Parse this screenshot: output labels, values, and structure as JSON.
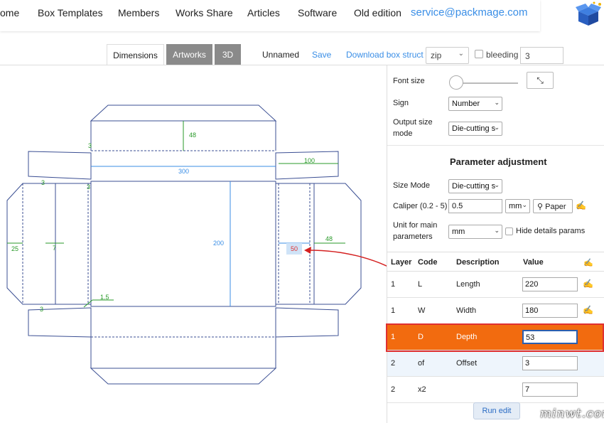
{
  "nav": {
    "items": [
      "ome",
      "Box Templates",
      "Members",
      "Works Share",
      "Articles",
      "Software",
      "Old edition"
    ],
    "email": "service@packmage.com"
  },
  "toolbar": {
    "tabs": [
      "Dimensions",
      "Artworks",
      "3D"
    ],
    "name": "Unnamed",
    "save": "Save",
    "download": "Download box struct",
    "format": "zip",
    "bleeding_label": "bleeding",
    "bleeding_value": "3"
  },
  "canvas": {
    "labels": {
      "top_height": "48",
      "left_flap": "100",
      "width": "300",
      "height": "200",
      "right_flap": "48",
      "left_tab": "25",
      "small_3a": "3",
      "small_3b": "3",
      "small_3c": "3",
      "small_3d": "3",
      "small_7": "7",
      "offset": "1.5",
      "depth": "50"
    }
  },
  "panel": {
    "font_size_label": "Font size",
    "font_size_level": 0,
    "sign_label": "Sign",
    "sign_value": "Number",
    "output_label_1": "Output size",
    "output_label_2": "mode",
    "output_value": "Die-cutting s",
    "section_title": "Parameter adjustment",
    "size_mode_label": "Size Mode",
    "size_mode_value": "Die-cutting s",
    "caliper_label": "Caliper (0.2 - 5)",
    "caliper_value": "0.5",
    "caliper_unit": "mm",
    "paper_button": "Paper",
    "unit_label_1": "Unit for main",
    "unit_label_2": "parameters",
    "unit_value": "mm",
    "hide_details": "Hide details params",
    "table": {
      "headers": [
        "Layer",
        "Code",
        "Description",
        "Value"
      ],
      "rows": [
        {
          "layer": "1",
          "code": "L",
          "desc": "Length",
          "value": "220"
        },
        {
          "layer": "1",
          "code": "W",
          "desc": "Width",
          "value": "180"
        },
        {
          "layer": "1",
          "code": "D",
          "desc": "Depth",
          "value": "53"
        },
        {
          "layer": "2",
          "code": "of",
          "desc": "Offset",
          "value": "3"
        },
        {
          "layer": "2",
          "code": "x2",
          "desc": "",
          "value": "7"
        }
      ]
    },
    "run_button": "Run edit"
  },
  "watermark": "minwt.com",
  "colors": {
    "accent": "#3a8ee6",
    "selected_row": "#f26b0f",
    "dieline": "#3b4f93",
    "dim_green": "#2a9a2a"
  }
}
